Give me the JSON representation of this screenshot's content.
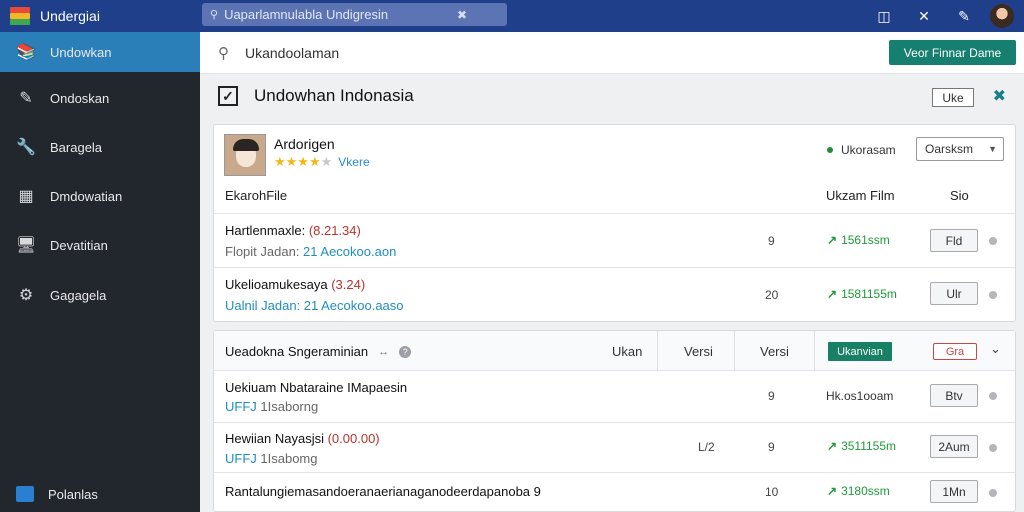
{
  "topbar": {
    "brand": "Undergiai",
    "search_value": "Uaparlamnulabla Undigresin",
    "icons": [
      "layout-icon",
      "x-icon",
      "pen-icon"
    ]
  },
  "sidebar": {
    "items": [
      {
        "label": "Undowkan",
        "icon": "book-icon",
        "active": true
      },
      {
        "label": "Ondoskan",
        "icon": "edit-icon",
        "active": false
      },
      {
        "label": "Baragela",
        "icon": "wrench-icon",
        "active": false
      },
      {
        "label": "Dmdowatian",
        "icon": "grid-icon",
        "active": false
      },
      {
        "label": "Devatitian",
        "icon": "monitor-icon",
        "active": false
      },
      {
        "label": "Gagagela",
        "icon": "gear-icon",
        "active": false
      }
    ],
    "footer": {
      "label": "Polanlas"
    }
  },
  "search": {
    "value": "Ukandoolaman",
    "button": "Veor Finnar Dame"
  },
  "page": {
    "title": "Undowhan Indonasia",
    "outline_btn": "Uke"
  },
  "profile": {
    "name": "Ardorigen",
    "rating": 4,
    "rating_label": "Vkere",
    "status": "Ukorasam",
    "select_value": "Oarsksm",
    "col_left": "EkarohFile",
    "col_mid": "Ukzam Film",
    "col_right": "Sio"
  },
  "rows1": [
    {
      "title": "Hartlenmaxle: ",
      "title_red": "(8.21.34)",
      "sub": "Flopit Jadan: ",
      "sub_blue": "21 Aecokoo.aon",
      "num": "9",
      "trend": "1561ssm",
      "btn": "Fld"
    },
    {
      "title": "Ukelioamukesaya ",
      "title_red": "(3.24)",
      "sub": "",
      "sub_blue": "Ualnil Jadan: 21 Aecokoo.aaso",
      "num": "20",
      "trend": "1581155m",
      "btn": "Ulr"
    }
  ],
  "section2": {
    "title": "Ueadokna Sngeraminian",
    "col1": "Ukan",
    "col2": "Versi",
    "col3": "Versi",
    "badge_green": "Ukanvian",
    "badge_red": "Gra"
  },
  "rows2": [
    {
      "title": "Uekiuam Nbataraine IMapaesin",
      "title_red": "",
      "sub_blue": "UFFJ",
      "sub": " 1Isaborng",
      "num_mid": "",
      "num": "9",
      "trend": "Hk.os1ooam",
      "trend_plain": true,
      "btn": "Btv"
    },
    {
      "title": "Hewiian Nayasjsi ",
      "title_red": "(0.00.00)",
      "sub_blue": "UFFJ",
      "sub": " 1Isabomg",
      "num_mid": "L/2",
      "num": "9",
      "trend": "3511155m",
      "trend_plain": false,
      "btn": "2Aum"
    },
    {
      "title": "Rantalungiemasandoeranaerianaganodeerdapanoba 9",
      "title_red": "",
      "sub_blue": "",
      "sub": "",
      "num_mid": "",
      "num": "10",
      "trend": "3180ssm",
      "trend_plain": false,
      "btn": "1Mn"
    }
  ],
  "colors": {
    "accent": "#167f70",
    "topbar": "#1f3f8a",
    "sidebar": "#22262d",
    "active": "#2a7fb8"
  }
}
